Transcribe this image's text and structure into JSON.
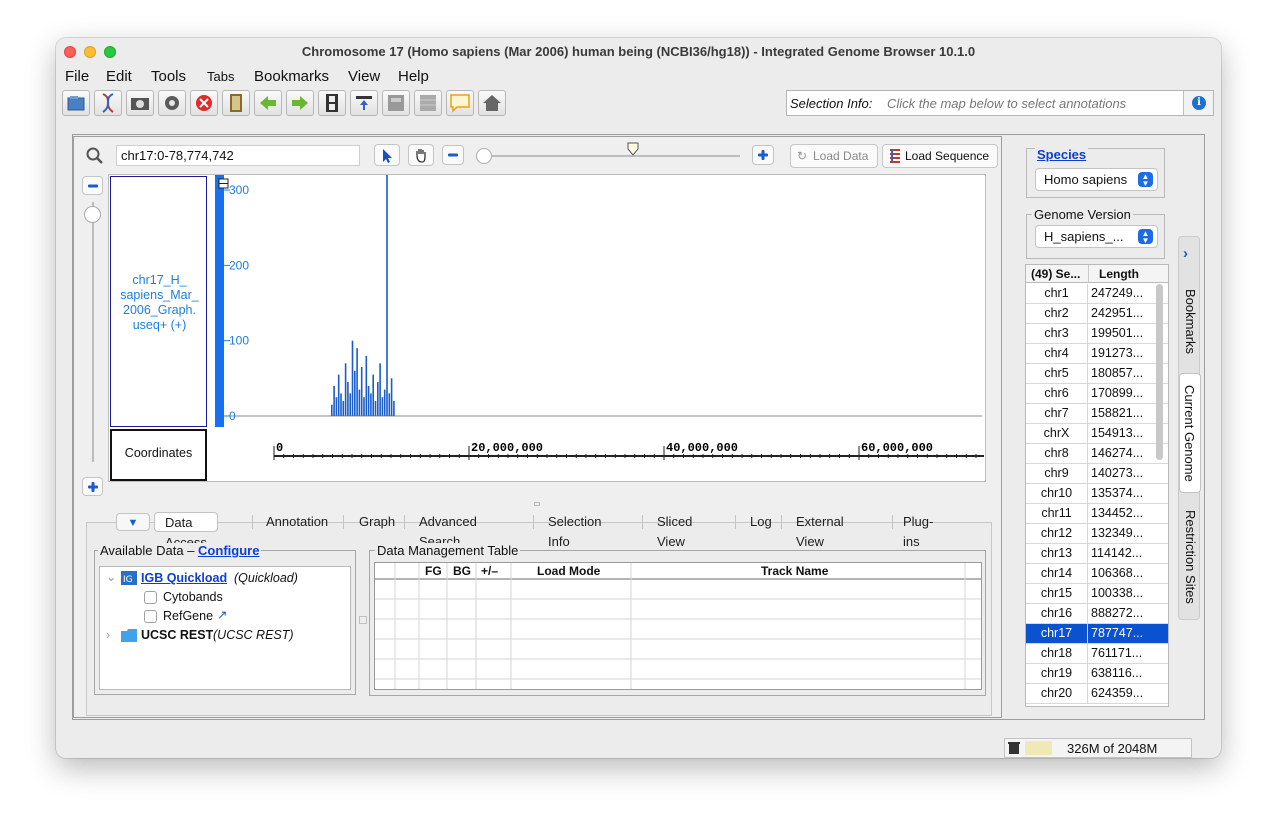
{
  "window": {
    "title": "Chromosome 17  (Homo sapiens (Mar 2006) human being (NCBI36/hg18)) - Integrated Genome Browser 10.1.0"
  },
  "menu": [
    "File",
    "Edit",
    "Tools",
    "Tabs",
    "Bookmarks",
    "View",
    "Help"
  ],
  "toolbar": {
    "icons": [
      "open-file-icon",
      "dna-icon",
      "camera-icon",
      "gear-icon",
      "stop-icon",
      "bookmark-book-icon",
      "back-arrow-icon",
      "forward-arrow-icon",
      "film-icon",
      "export-icon",
      "panel-icon",
      "grid-icon",
      "comment-icon",
      "home-icon"
    ],
    "selection_info_label": "Selection Info:",
    "selection_info_placeholder": "Click the map below to select annotations"
  },
  "location": {
    "value": "chr17:0-78,774,742"
  },
  "buttons": {
    "load_data": "Load Data",
    "load_sequence": "Load Sequence"
  },
  "tracks": {
    "graph_label": "chr17_H_ sapiens_Mar_ 2006_Graph. useq+ (+)",
    "coordinates_label": "Coordinates",
    "y_ticks": [
      "300",
      "200",
      "100",
      "0"
    ],
    "x_ticks": [
      "0",
      "20,000,000",
      "40,000,000",
      "60,000,000"
    ]
  },
  "chart_data": {
    "type": "bar",
    "x_unit": "bp",
    "ylim": [
      0,
      320
    ],
    "xlim": [
      0,
      78774742
    ],
    "bins_start": 12000000,
    "bins_step": 300000,
    "values": [
      15,
      40,
      25,
      55,
      30,
      20,
      70,
      45,
      30,
      100,
      60,
      90,
      35,
      65,
      25,
      80,
      40,
      30,
      55,
      20,
      45,
      70,
      25,
      35,
      320,
      30,
      50,
      20
    ]
  },
  "bottom_tabs": [
    "Data Access",
    "Annotation",
    "Graph",
    "Advanced Search",
    "Selection Info",
    "Sliced View",
    "Log",
    "External View",
    "Plug-ins"
  ],
  "available_data": {
    "title": "Available Data – ",
    "configure": "Configure",
    "quickload_name": "IGB Quickload",
    "quickload_kind": "(Quickload)",
    "cytobands": "Cytobands",
    "refgene": "RefGene",
    "ucsc_name": "UCSC REST",
    "ucsc_kind": "(UCSC REST)"
  },
  "data_management": {
    "title": "Data Management Table",
    "columns": [
      "",
      "",
      "FG",
      "BG",
      "+/–",
      "Load Mode",
      "Track Name",
      ""
    ]
  },
  "species": {
    "title": "Species",
    "value": "Homo sapiens"
  },
  "genome_version": {
    "title": "Genome Version",
    "value": "H_sapiens_..."
  },
  "sequences": {
    "header_name": "(49) Se...",
    "header_length": "Length",
    "rows": [
      {
        "name": "chr1",
        "length": "247249..."
      },
      {
        "name": "chr2",
        "length": "242951..."
      },
      {
        "name": "chr3",
        "length": "199501..."
      },
      {
        "name": "chr4",
        "length": "191273..."
      },
      {
        "name": "chr5",
        "length": "180857..."
      },
      {
        "name": "chr6",
        "length": "170899..."
      },
      {
        "name": "chr7",
        "length": "158821..."
      },
      {
        "name": "chrX",
        "length": "154913..."
      },
      {
        "name": "chr8",
        "length": "146274..."
      },
      {
        "name": "chr9",
        "length": "140273..."
      },
      {
        "name": "chr10",
        "length": "135374..."
      },
      {
        "name": "chr11",
        "length": "134452..."
      },
      {
        "name": "chr12",
        "length": "132349..."
      },
      {
        "name": "chr13",
        "length": "114142..."
      },
      {
        "name": "chr14",
        "length": "106368..."
      },
      {
        "name": "chr15",
        "length": "100338..."
      },
      {
        "name": "chr16",
        "length": "888272..."
      },
      {
        "name": "chr17",
        "length": "787747...",
        "selected": true
      },
      {
        "name": "chr18",
        "length": "761171..."
      },
      {
        "name": "chr19",
        "length": "638116..."
      },
      {
        "name": "chr20",
        "length": "624359..."
      }
    ]
  },
  "side_tabs": [
    "Bookmarks",
    "Current Genome",
    "Restriction Sites"
  ],
  "status": {
    "memory": "326M of 2048M"
  },
  "colors": {
    "accent": "#0b52d1",
    "graph": "#1a5cc8",
    "link": "#0b3fd1",
    "tick_label": "#1d7fe0"
  }
}
